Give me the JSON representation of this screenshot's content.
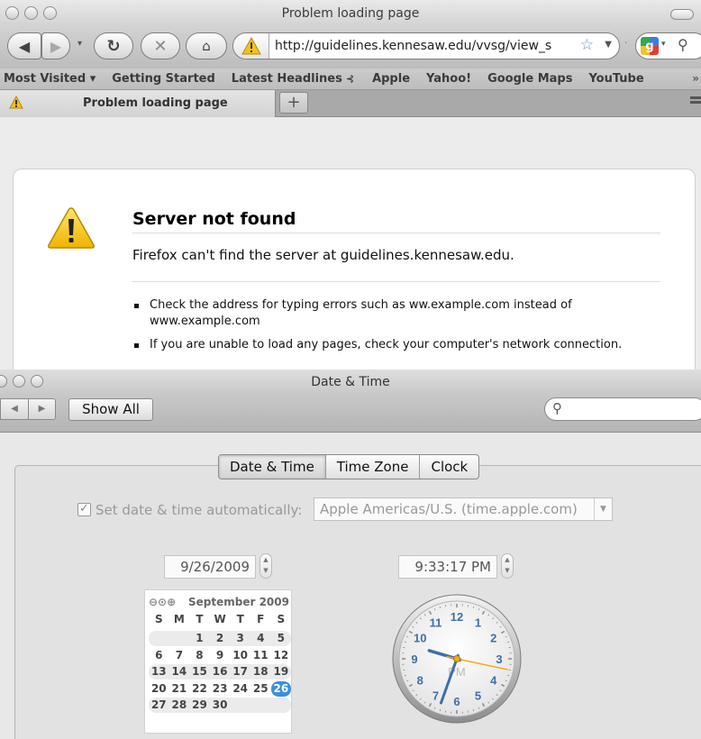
{
  "firefox": {
    "window_title": "Problem loading page",
    "url": "http://guidelines.kennesaw.edu/vvsg/view_s",
    "bookmarks": {
      "most_visited": "Most Visited ▾",
      "items": [
        "Getting Started",
        "Latest Headlines",
        "Apple",
        "Yahoo!",
        "Google Maps",
        "YouTube"
      ],
      "overflow": "»"
    },
    "tab_title": "Problem loading page",
    "new_tab": "+",
    "error": {
      "title": "Server not found",
      "description": "Firefox can't find the server at guidelines.kennesaw.edu.",
      "tips": [
        "Check the address for typing errors such as ww.example.com instead of www.example.com",
        "If you are unable to load any pages, check your computer's network connection."
      ]
    }
  },
  "datetime": {
    "window_title": "Date & Time",
    "show_all": "Show All",
    "tabs": [
      "Date & Time",
      "Time Zone",
      "Clock"
    ],
    "selected_tab": "Date & Time",
    "auto_label": "Set date & time automatically:",
    "auto_checked": true,
    "server": "Apple Americas/U.S. (time.apple.com)",
    "date": "9/26/2009",
    "time": "9:33:17 PM",
    "calendar": {
      "month": "September 2009",
      "weekdays": [
        "S",
        "M",
        "T",
        "W",
        "T",
        "F",
        "S"
      ],
      "weeks": [
        [
          "",
          "",
          "1",
          "2",
          "3",
          "4",
          "5"
        ],
        [
          "6",
          "7",
          "8",
          "9",
          "10",
          "11",
          "12"
        ],
        [
          "13",
          "14",
          "15",
          "16",
          "17",
          "18",
          "19"
        ],
        [
          "20",
          "21",
          "22",
          "23",
          "24",
          "25",
          "26"
        ],
        [
          "27",
          "28",
          "29",
          "30",
          "",
          "",
          ""
        ]
      ],
      "selected": "26"
    },
    "clock": {
      "hour": 9,
      "minute": 33,
      "second": 17,
      "ampm": "PM",
      "numbers": [
        "12",
        "1",
        "2",
        "3",
        "4",
        "5",
        "6",
        "7",
        "8",
        "9",
        "10",
        "11"
      ],
      "accent": "#3f6ea8",
      "second_hand_color": "#f0a818"
    }
  }
}
